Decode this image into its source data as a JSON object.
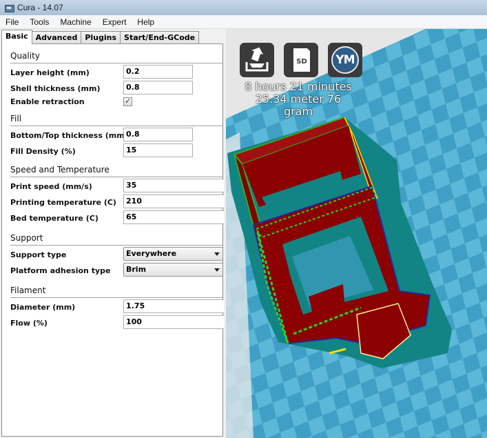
{
  "window": {
    "title": "Cura - 14.07"
  },
  "menu": [
    "File",
    "Tools",
    "Machine",
    "Expert",
    "Help"
  ],
  "tabs": [
    "Basic",
    "Advanced",
    "Plugins",
    "Start/End-GCode"
  ],
  "sections": {
    "quality": {
      "title": "Quality",
      "layer_height": {
        "label": "Layer height (mm)",
        "value": "0.2"
      },
      "shell_thickness": {
        "label": "Shell thickness (mm)",
        "value": "0.8"
      },
      "enable_retraction": {
        "label": "Enable retraction",
        "checked": true
      }
    },
    "fill": {
      "title": "Fill",
      "bottom_top": {
        "label": "Bottom/Top thickness (mm)",
        "value": "0.8"
      },
      "density": {
        "label": "Fill Density (%)",
        "value": "15"
      }
    },
    "speed": {
      "title": "Speed and Temperature",
      "print_speed": {
        "label": "Print speed (mm/s)",
        "value": "35"
      },
      "print_temp": {
        "label": "Printing temperature (C)",
        "value": "210"
      },
      "bed_temp": {
        "label": "Bed temperature (C)",
        "value": "65"
      }
    },
    "support": {
      "title": "Support",
      "support_type": {
        "label": "Support type",
        "value": "Everywhere"
      },
      "adhesion": {
        "label": "Platform adhesion type",
        "value": "Brim"
      }
    },
    "filament": {
      "title": "Filament",
      "diameter": {
        "label": "Diameter (mm)",
        "value": "1.75"
      },
      "flow": {
        "label": "Flow (%)",
        "value": "100"
      }
    }
  },
  "viewport": {
    "buttons": {
      "load_icon": "load-model-icon",
      "sd_label": "SD",
      "ym_label": "YM"
    },
    "print_time": "8 hours 21 minutes",
    "print_material": "25.34 meter 76 gram"
  },
  "colors": {
    "model_red": "#8b0000",
    "bed_light": "#5cb8d8",
    "bed_dark": "#3f9fc4",
    "support_teal": "#138484"
  }
}
